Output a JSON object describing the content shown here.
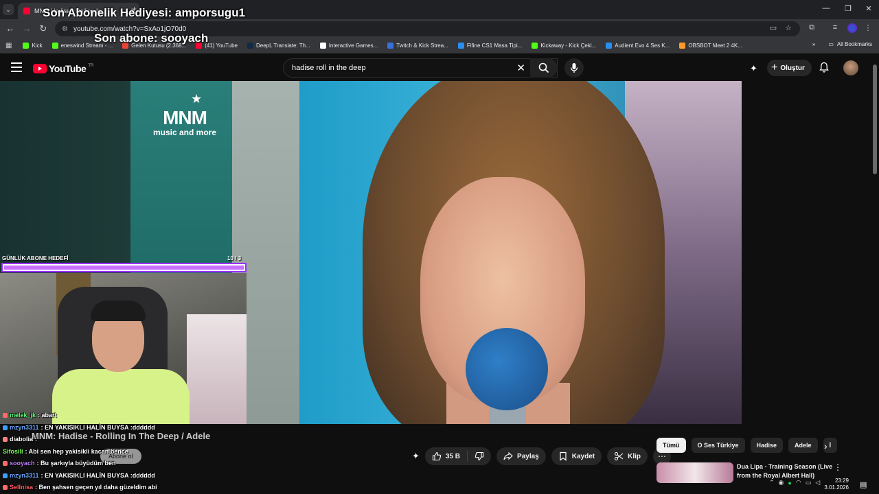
{
  "overlay": {
    "last_gift": "Son Abonelik Hediyesi: amporsugu1",
    "last_sub": "Son abone: sooyach",
    "goal_label": "GÜNLÜK ABONE HEDEFİ",
    "goal_count": "10 / 3",
    "goal_progress": 1.0
  },
  "browser": {
    "tab_title": "MNM Hadise - Rolling In",
    "url": "youtube.com/watch?v=SxAo1jO70d0",
    "bookmarks": [
      {
        "label": "Kick",
        "color": "#53fc18"
      },
      {
        "label": "eneswind Stream - ...",
        "color": "#53fc18"
      },
      {
        "label": "Gelen Kutusu (2.368...",
        "color": "#ea4335"
      },
      {
        "label": "(41) YouTube",
        "color": "#ff0033"
      },
      {
        "label": "DeepL Translate: Th...",
        "color": "#0f2b46"
      },
      {
        "label": "Interactive Games...",
        "color": "#ffffff"
      },
      {
        "label": "Twitch & Kick Strea...",
        "color": "#3a6fd8"
      },
      {
        "label": "Fifine CS1 Masa Tipi...",
        "color": "#2a8ef0"
      },
      {
        "label": "Kickaway - Kick Çeki...",
        "color": "#53fc18"
      },
      {
        "label": "Audient Evo 4 Ses K...",
        "color": "#2a8ef0"
      },
      {
        "label": "OBSBOT Meet 2 4K...",
        "color": "#ff9a2a"
      }
    ],
    "all_bookmarks": "All Bookmarks"
  },
  "youtube": {
    "logo_text": "YouTube",
    "region": "TR",
    "search_value": "hadise roll in the deep",
    "create_label": "Oluştur",
    "video_title": "MNM: Hadise - Rolling In The Deep / Adele",
    "subscribe_label": "Abone ol",
    "like_count": "35 B",
    "share_label": "Paylaş",
    "save_label": "Kaydet",
    "clip_label": "Klip",
    "chips": [
      "Tümü",
      "O Ses Türkiye",
      "Hadise",
      "Adele",
      "İ"
    ],
    "rec_title": "Dua Lipa - Training Season (Live from the Royal Albert Hall)"
  },
  "video_overlay": {
    "brand": "MNM",
    "brand_sub": "music and more"
  },
  "chat": [
    {
      "user": "melek_jk",
      "color": "#5bff7a",
      "msg": ": abart",
      "badge": "#ff6b6b"
    },
    {
      "user": "mzyn3311",
      "color": "#6aa8ff",
      "msg": ": EN YAKISIKLI HALİN BUYSA :dddddd",
      "badge": "#3aa0ff"
    },
    {
      "user": "diabolia",
      "color": "#ffffff",
      "msg": ":",
      "badge": "#ff8080"
    },
    {
      "user": "Sifosili",
      "color": "#7dff5a",
      "msg": ": Abi sen hep yakisikli kacan bence",
      "badge": ""
    },
    {
      "user": "sooyach",
      "color": "#c07cff",
      "msg": ": Bu şarkıyla büyüdüm ben",
      "badge": "#ff6b6b"
    },
    {
      "user": "mzyn3311",
      "color": "#6aa8ff",
      "msg": ": EN YAKISIKLI HALİN BUYSA :dddddd",
      "badge": "#3aa0ff"
    },
    {
      "user": "Sellnisa",
      "color": "#ff5a5a",
      "msg": ": Ben şahsen geçen yıl daha güzeldim abi",
      "badge": "#ff6b6b"
    }
  ],
  "system": {
    "time": "23:29",
    "date": "3.01.2026"
  }
}
